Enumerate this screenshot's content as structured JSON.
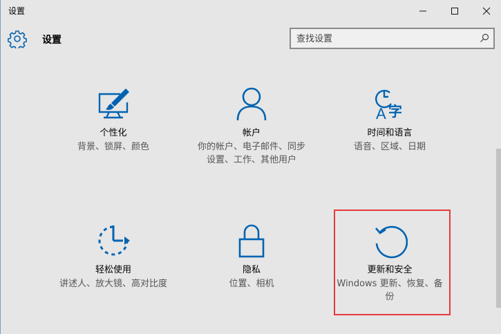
{
  "window": {
    "title": "设置",
    "controls": {
      "minimize_icon": "minimize-icon",
      "maximize_icon": "maximize-icon",
      "close_icon": "close-icon"
    }
  },
  "header": {
    "title": "设置",
    "icon": "gear-icon"
  },
  "search": {
    "placeholder": "查找设置",
    "value": "",
    "icon": "search-icon"
  },
  "tiles": [
    {
      "name": "个性化",
      "description": "背景、锁屏、颜色",
      "icon": "personalization-icon"
    },
    {
      "name": "帐户",
      "description": "你的帐户、电子邮件、同步设置、工作、其他用户",
      "icon": "accounts-icon"
    },
    {
      "name": "时间和语言",
      "description": "语音、区域、日期",
      "icon": "time-language-icon"
    },
    {
      "name": "轻松使用",
      "description": "讲述人、放大镜、高对比度",
      "icon": "ease-of-access-icon"
    },
    {
      "name": "隐私",
      "description": "位置、相机",
      "icon": "lock-icon"
    },
    {
      "name": "更新和安全",
      "description": "Windows 更新、恢复、备份",
      "icon": "update-security-icon"
    }
  ],
  "colors": {
    "accent": "#0063b1",
    "highlight": "#e8383d",
    "background": "#e6e6e6"
  }
}
